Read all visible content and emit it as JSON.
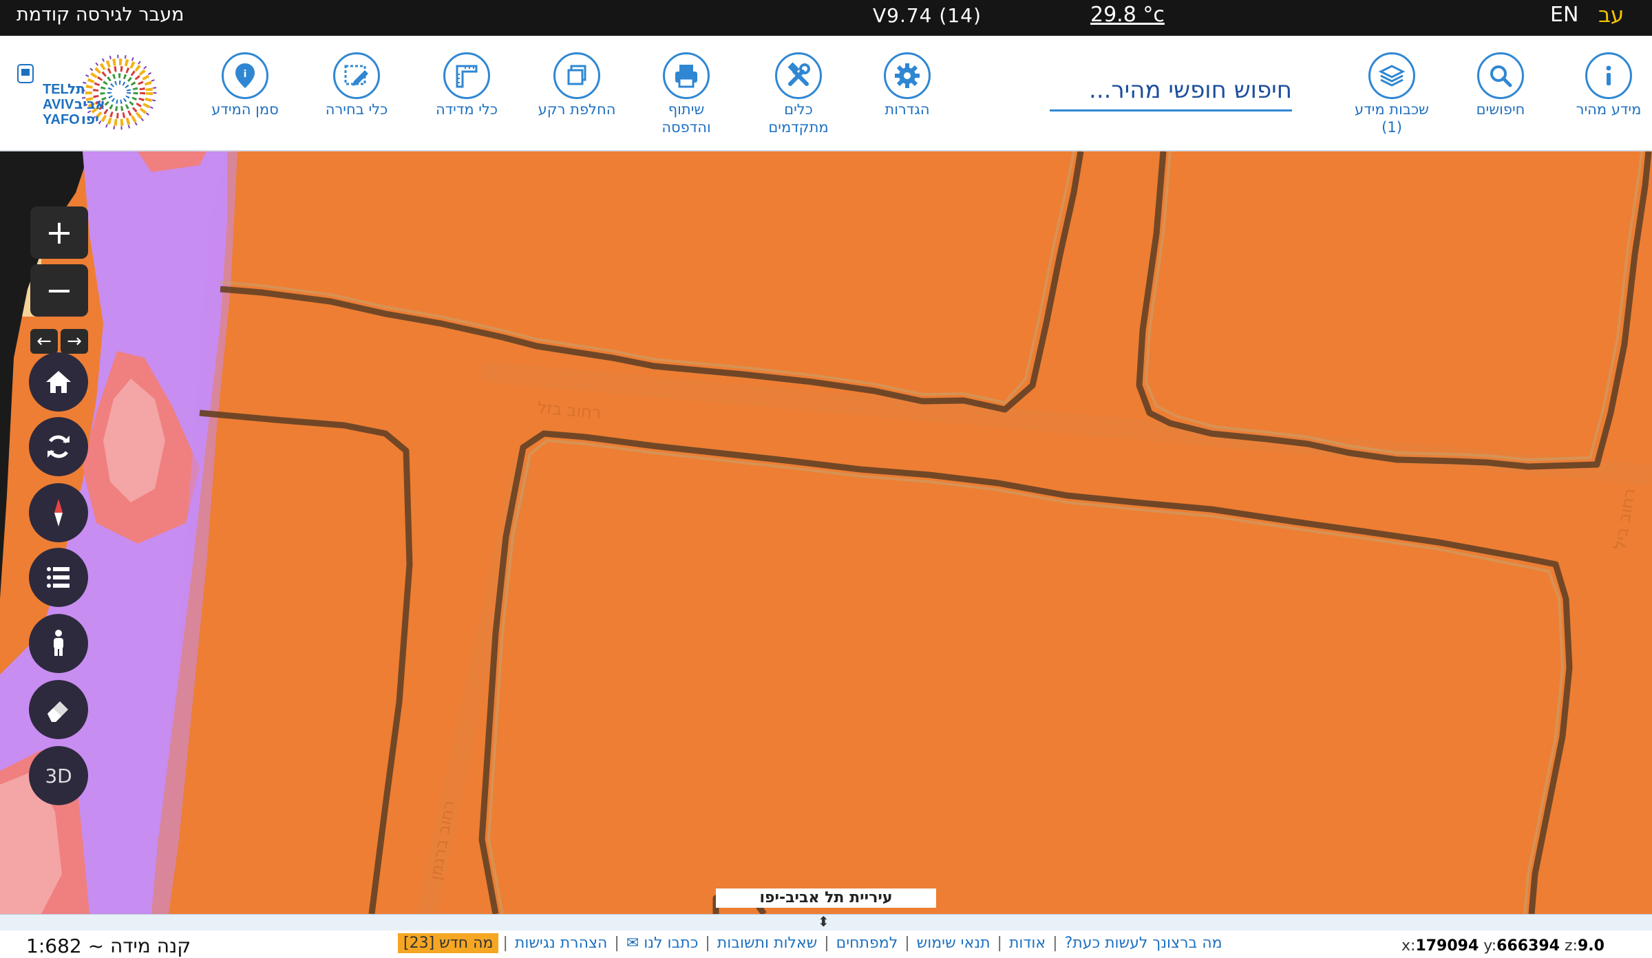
{
  "topbar": {
    "prev_version": "מעבר לגירסה קודמת",
    "version": "V9.74 (14)",
    "temperature": "29.8 °c",
    "lang_en": "EN",
    "lang_he": "עב"
  },
  "toolbar": {
    "quick_info": "מידע מהיר",
    "searches": "חיפושים",
    "layers_line1": "שכבות מידע",
    "layers_line2": "(1)",
    "search_placeholder": "חיפוש חופשי מהיר...",
    "settings": "הגדרות",
    "advanced_line1": "כלים",
    "advanced_line2": "מתקדמים",
    "share_line1": "שיתוף",
    "share_line2": "והדפסה",
    "basemap": "החלפת רקע",
    "measure": "כלי מדידה",
    "select": "כלי בחירה",
    "marker": "סמן המידע"
  },
  "logo": {
    "text_en1": "TEL",
    "text_en2": "AVIV",
    "text_en3": "YAFO",
    "text_he1": "תל",
    "text_he2": "אביב",
    "text_he3": "יפו"
  },
  "map": {
    "city_label": "עיריית תל אביב-יפו",
    "street1": "רחוב בזל",
    "street2": "רחוב ברגמן",
    "street3": "רחוב ביל",
    "ctrl_3d": "3D",
    "zoom_in": "+",
    "zoom_out": "−",
    "arrow_back": "←",
    "arrow_fwd": "→"
  },
  "status": {
    "handle_arrow": "⬍",
    "scale": "קנה מידה ~ 1:682",
    "links": [
      "מה ברצונך לעשות כעת?",
      "אודות",
      "תנאי שימוש",
      "למפתחים",
      "שאלות ותשובות",
      "כתבו לנו ✉",
      "הצהרת נגישות"
    ],
    "whats_new": "מה חדש [23]",
    "x_label": "x:",
    "x": "179094",
    "y_label": "y:",
    "y": "666394",
    "z_label": "z:",
    "z": "9.0"
  },
  "colors": {
    "map_orange": "#ed7e33",
    "parcel_border": "#6b4426",
    "violet": "#c88df0",
    "pink": "#f07f7f",
    "accent": "#2f87d3",
    "topbar_bg": "#151515"
  }
}
